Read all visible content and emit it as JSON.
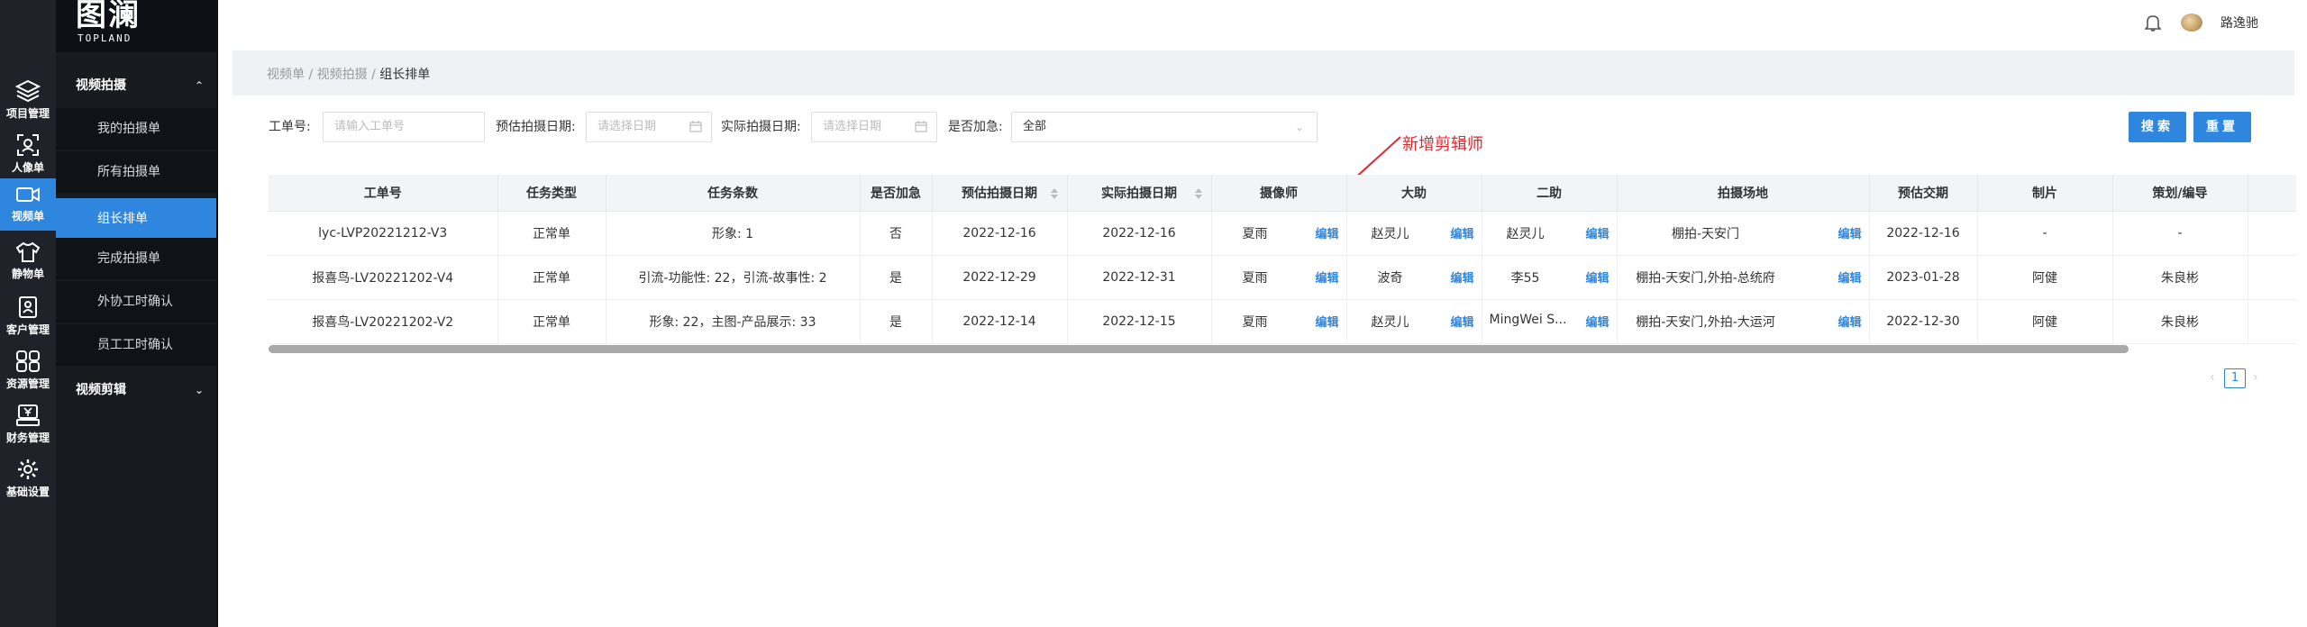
{
  "logo": {
    "mark": "图澜",
    "sub": "TOPLAND"
  },
  "rail": [
    {
      "label": "项目管理",
      "icon": "layers-icon"
    },
    {
      "label": "人像单",
      "icon": "face-scan-icon"
    },
    {
      "label": "视频单",
      "icon": "video-camera-icon"
    },
    {
      "label": "静物单",
      "icon": "tshirt-icon"
    },
    {
      "label": "客户管理",
      "icon": "contact-card-icon"
    },
    {
      "label": "资源管理",
      "icon": "grid-icon"
    },
    {
      "label": "财务管理",
      "icon": "yen-register-icon"
    },
    {
      "label": "基础设置",
      "icon": "gear-icon"
    }
  ],
  "subnav": {
    "group1": "视频拍摄",
    "items": [
      "我的拍摄单",
      "所有拍摄单",
      "组长排单",
      "完成拍摄单",
      "外协工时确认",
      "员工工时确认"
    ],
    "group2": "视频剪辑"
  },
  "header": {
    "username": "路逸驰"
  },
  "breadcrumb": {
    "a": "视频单",
    "b": "视频拍摄",
    "current": "组长排单",
    "sep": " / "
  },
  "filters": {
    "order_no_label": "工单号:",
    "order_no_placeholder": "请输入工单号",
    "est_date_label": "预估拍摄日期:",
    "est_date_placeholder": "请选择日期",
    "act_date_label": "实际拍摄日期:",
    "act_date_placeholder": "请选择日期",
    "urgent_label": "是否加急:",
    "urgent_value": "全部"
  },
  "buttons": {
    "search": "搜索",
    "reset": "重置"
  },
  "annotation": "新增剪辑师",
  "table": {
    "columns": [
      "工单号",
      "任务类型",
      "任务条数",
      "是否加急",
      "预估拍摄日期",
      "实际拍摄日期",
      "摄像师",
      "大助",
      "二助",
      "拍摄场地",
      "预估交期",
      "制片",
      "策划/编导"
    ],
    "edit_label": "编辑",
    "rows": [
      [
        "lyc-LVP20221212-V3",
        "正常单",
        "形象: 1",
        "否",
        "2022-12-16",
        "2022-12-16",
        "夏雨",
        "赵灵儿",
        "赵灵儿",
        "棚拍-天安门",
        "2022-12-16",
        "-",
        "-"
      ],
      [
        "报喜鸟-LV20221202-V4",
        "正常单",
        "引流-功能性: 22，引流-故事性: 2",
        "是",
        "2022-12-29",
        "2022-12-31",
        "夏雨",
        "波奇",
        "李55",
        "棚拍-天安门,外拍-总统府",
        "2023-01-28",
        "阿健",
        "朱良彬"
      ],
      [
        "报喜鸟-LV20221202-V2",
        "正常单",
        "形象: 22，主图-产品展示: 33",
        "是",
        "2022-12-14",
        "2022-12-15",
        "夏雨",
        "赵灵儿",
        "MingWei S...",
        "棚拍-天安门,外拍-大运河",
        "2022-12-30",
        "阿健",
        "朱良彬"
      ]
    ]
  },
  "pagination": {
    "prev": "‹",
    "current": "1",
    "next": "›"
  }
}
